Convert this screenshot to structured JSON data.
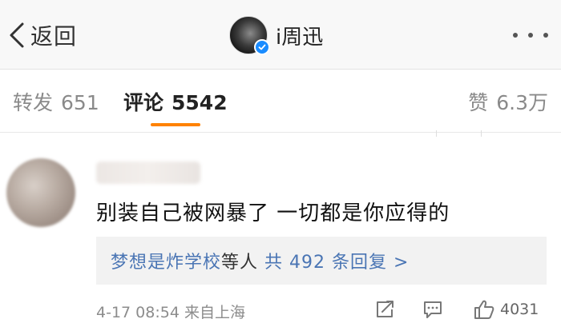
{
  "navbar": {
    "back_label": "返回",
    "title": "i周迅",
    "icons": {
      "back": "chevron-left-icon",
      "more": "more-dots-icon",
      "verified": "verified-badge-icon"
    }
  },
  "tabs": [
    {
      "label": "转发",
      "count": "651",
      "active": false
    },
    {
      "label": "评论",
      "count": "5542",
      "active": true
    },
    {
      "label": "赞",
      "count": "6.3万",
      "active": false
    }
  ],
  "colors": {
    "accent": "#ff8200",
    "link_blue": "#4a75b4",
    "verified_blue": "#1a8cff",
    "reply_bg": "#f2f2f2"
  },
  "comment": {
    "text": "别装自己被网暴了 一切都是你应得的",
    "reply_preview": {
      "user": "梦想是炸学校",
      "suffix": "等人",
      "summary": "共 492 条回复 >"
    },
    "timestamp": "4-17 08:54 来自上海",
    "likes": "4031",
    "icons": {
      "share": "share-icon",
      "reply": "comment-icon",
      "like": "thumbs-up-icon"
    }
  }
}
